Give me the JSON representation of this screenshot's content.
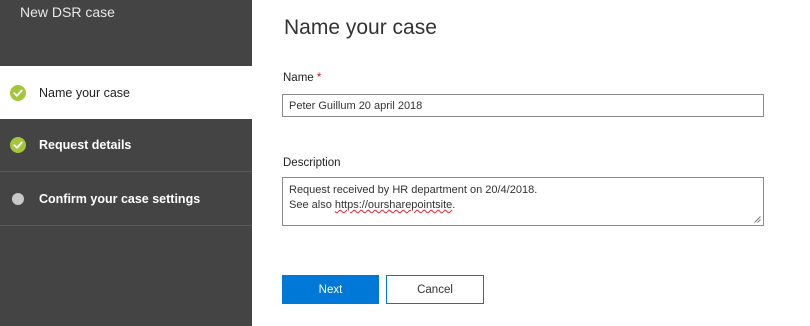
{
  "sidebar": {
    "title": "New DSR case",
    "steps": [
      {
        "label": "Name your case",
        "status": "complete",
        "active": true
      },
      {
        "label": "Request details",
        "status": "complete",
        "active": false
      },
      {
        "label": "Confirm your case settings",
        "status": "pending",
        "active": false
      }
    ]
  },
  "main": {
    "title": "Name your case",
    "name_field": {
      "label": "Name",
      "required_mark": "*",
      "value": "Peter Guillum 20 april 2018"
    },
    "description_field": {
      "label": "Description",
      "line1": "Request received by HR department on 20/4/2018.",
      "line2_prefix": "See also ",
      "line2_link": "https://oursharepointsite",
      "line2_suffix": "."
    },
    "buttons": {
      "next": "Next",
      "cancel": "Cancel"
    }
  },
  "colors": {
    "sidebar_bg": "#444444",
    "check_green": "#a4c639",
    "pending_dot": "#c8c8c8",
    "primary": "#0078d7",
    "required": "#c0161e"
  }
}
